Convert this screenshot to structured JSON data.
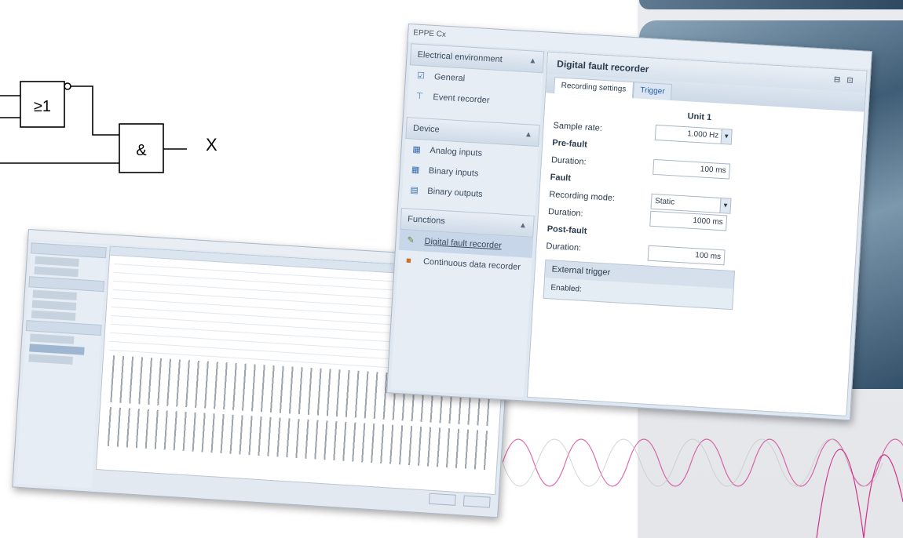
{
  "logic_diagram": {
    "or_gate_label": "≥1",
    "and_gate_label": "&",
    "output_label": "X"
  },
  "dialog": {
    "title": "EPPE Cx",
    "nav": {
      "sections": [
        {
          "label": "Electrical environment",
          "items": [
            {
              "label": "General",
              "icon": "checkbox-icon"
            },
            {
              "label": "Event recorder",
              "icon": "pin-icon"
            }
          ]
        },
        {
          "label": "Device",
          "items": [
            {
              "label": "Analog inputs",
              "icon": "analog-inputs-icon"
            },
            {
              "label": "Binary inputs",
              "icon": "binary-inputs-icon"
            },
            {
              "label": "Binary outputs",
              "icon": "binary-outputs-icon"
            }
          ]
        },
        {
          "label": "Functions",
          "items": [
            {
              "label": "Digital fault recorder",
              "icon": "fault-recorder-icon",
              "selected": true
            },
            {
              "label": "Continuous data recorder",
              "icon": "data-recorder-icon"
            }
          ]
        }
      ]
    },
    "content": {
      "header": "Digital fault recorder",
      "tabs": [
        "Recording settings",
        "Trigger"
      ],
      "unit_header": "Unit 1",
      "sample_rate_label": "Sample rate:",
      "sample_rate_value": "1.000 Hz",
      "prefault_label": "Pre-fault",
      "prefault_duration_label": "Duration:",
      "prefault_duration_value": "100 ms",
      "fault_label": "Fault",
      "recording_mode_label": "Recording mode:",
      "recording_mode_value": "Static",
      "fault_duration_label": "Duration:",
      "fault_duration_value": "1000 ms",
      "postfault_label": "Post-fault",
      "postfault_duration_label": "Duration:",
      "postfault_duration_value": "100 ms",
      "external_trigger_label": "External trigger",
      "enabled_label": "Enabled:"
    }
  },
  "colors": {
    "accent_blue": "#3c6ea8",
    "wave_pink": "#d0308a",
    "side_panel": "#2f4b63"
  }
}
